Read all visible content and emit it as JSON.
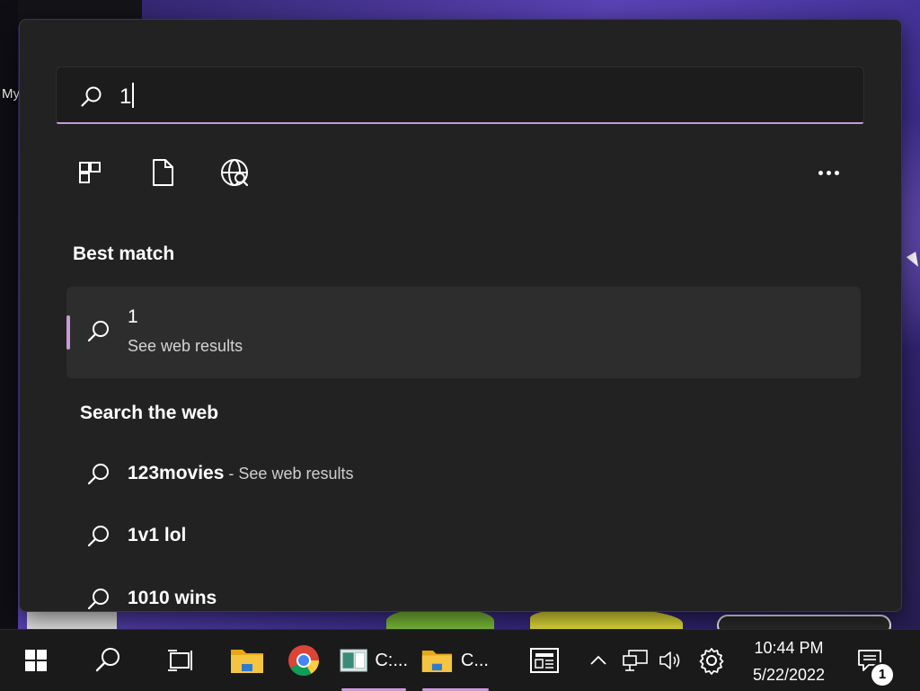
{
  "desktop": {
    "partial_label": "My"
  },
  "search": {
    "query": "1",
    "filters": [
      {
        "name": "apps-filter-icon"
      },
      {
        "name": "documents-filter-icon"
      },
      {
        "name": "web-filter-icon"
      }
    ],
    "more_icon": "more-options-icon"
  },
  "best_match": {
    "heading": "Best match",
    "title": "1",
    "subtitle": "See web results"
  },
  "search_the_web": {
    "heading": "Search the web",
    "items": [
      {
        "label": "123movies",
        "hint": " - See web results"
      },
      {
        "label": "1v1 lol",
        "hint": ""
      },
      {
        "label": "1010 wins",
        "hint": ""
      }
    ]
  },
  "taskbar": {
    "apps": [
      {
        "name": "start-button",
        "icon": "windows-logo-icon"
      },
      {
        "name": "search-button",
        "icon": "search-icon"
      },
      {
        "name": "task-view-button",
        "icon": "task-view-icon"
      },
      {
        "name": "file-explorer-button",
        "icon": "folder-icon"
      },
      {
        "name": "chrome-button",
        "icon": "chrome-icon"
      },
      {
        "name": "cmd-window-button",
        "icon": "window-icon",
        "label": "C:..."
      },
      {
        "name": "folder-window-button",
        "icon": "folder-icon",
        "label": "C..."
      },
      {
        "name": "news-widget-button",
        "icon": "news-icon"
      }
    ],
    "tray": {
      "time": "10:44 PM",
      "date": "5/22/2022",
      "notification_count": "1"
    },
    "accent_color": "#c89ad8"
  }
}
